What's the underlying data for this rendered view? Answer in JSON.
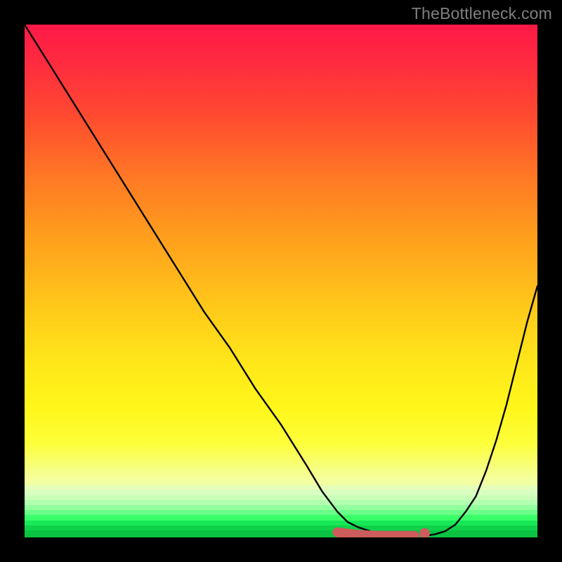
{
  "watermark": "TheBottleneck.com",
  "colors": {
    "gradient_top": "#ff1847",
    "gradient_mid": "#ffd81a",
    "gradient_bottom": "#0bc242",
    "curve": "#000000",
    "highlight": "#cd5c5c",
    "frame": "#000000"
  },
  "chart_data": {
    "type": "line",
    "title": "",
    "xlabel": "",
    "ylabel": "",
    "xlim": [
      0,
      100
    ],
    "ylim": [
      0,
      100
    ],
    "series": [
      {
        "name": "curve-A",
        "x": [
          0,
          5,
          10,
          15,
          20,
          25,
          30,
          35,
          40,
          45,
          50,
          55,
          58,
          61,
          63,
          65,
          68,
          71,
          74,
          76
        ],
        "values": [
          100,
          92,
          84,
          76,
          68,
          60,
          52,
          44,
          37,
          29,
          22,
          14,
          9,
          5,
          3,
          2,
          1,
          0.5,
          0.3,
          0.2
        ]
      },
      {
        "name": "curve-B",
        "x": [
          78,
          80,
          82,
          84,
          86,
          88,
          90,
          92,
          94,
          96,
          98,
          100
        ],
        "values": [
          0.3,
          0.6,
          1.2,
          2.5,
          5,
          8,
          13,
          19,
          26,
          34,
          42,
          49
        ]
      },
      {
        "name": "highlight-segment",
        "x": [
          61,
          64,
          67,
          70,
          73,
          76
        ],
        "values": [
          1.0,
          0.6,
          0.4,
          0.3,
          0.3,
          0.3
        ]
      }
    ],
    "annotations": [
      {
        "type": "dot",
        "x": 78,
        "y": 0.8,
        "color": "#cd5c5c"
      }
    ],
    "notes": "No visible axis ticks or numeric labels in image; x and y are normalized percent of plot area. Curve-A descends from top-left to a minimum near x≈74; curve-B rises from x≈78 to right edge at roughly half height. The highlight segment traces the basin near the minimum."
  }
}
